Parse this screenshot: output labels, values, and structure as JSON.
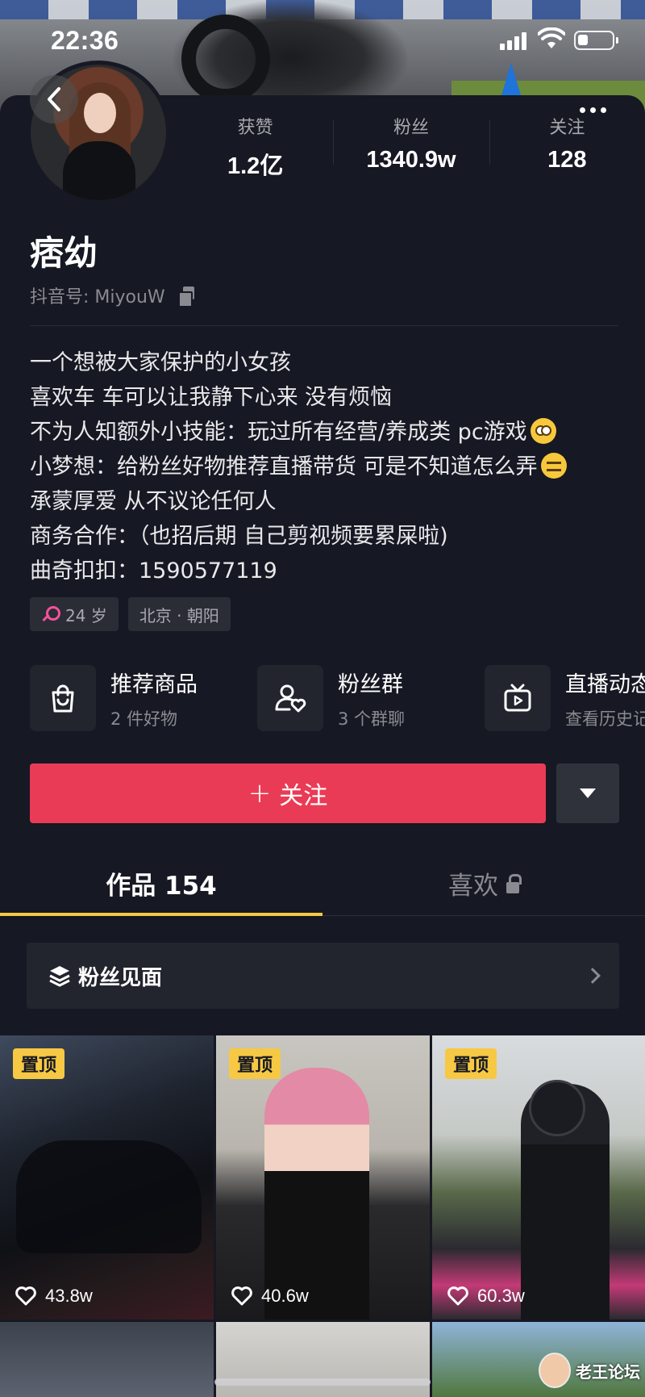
{
  "status_bar": {
    "time": "22:36"
  },
  "profile": {
    "name": "痞幼",
    "douyin_id": "抖音号: MiyouW",
    "stats": [
      {
        "label": "获赞",
        "value": "1.2亿"
      },
      {
        "label": "粉丝",
        "value": "1340.9w"
      },
      {
        "label": "关注",
        "value": "128"
      }
    ],
    "bio": [
      "一个想被大家保护的小女孩",
      "喜欢车 车可以让我静下心来 没有烦恼",
      "不为人知额外小技能：玩过所有经营/养成类 pc游戏",
      "小梦想：给粉丝好物推荐直播带货 可是不知道怎么弄",
      "承蒙厚爱 从不议论任何人",
      "商务合作：（也招后期 自己剪视频要累屎啦)",
      "曲奇扣扣：1590577119"
    ],
    "tags": {
      "age": "24 岁",
      "location": "北京 · 朝阳"
    }
  },
  "features": [
    {
      "title": "推荐商品",
      "subtitle": "2 件好物",
      "icon": "shopping-bag-icon"
    },
    {
      "title": "粉丝群",
      "subtitle": "3 个群聊",
      "icon": "fan-group-icon"
    },
    {
      "title": "直播动态",
      "subtitle": "查看历史记",
      "icon": "live-tv-icon"
    }
  ],
  "actions": {
    "follow_label": "关注",
    "follow_plus": "+"
  },
  "tabs": {
    "works": "作品 154",
    "likes": "喜欢"
  },
  "fans_meet": {
    "label": "粉丝见面"
  },
  "videos": [
    {
      "pinned": "置顶",
      "likes": "43.8w"
    },
    {
      "pinned": "置顶",
      "likes": "40.6w"
    },
    {
      "pinned": "置顶",
      "likes": "60.3w"
    }
  ],
  "watermark": {
    "text": "老王论坛"
  },
  "colors": {
    "background": "#161823",
    "follow_button": "#ea3b56",
    "tab_indicator": "#f6c844",
    "pin_badge": "#f6c844",
    "gender_female": "#f6519b"
  }
}
